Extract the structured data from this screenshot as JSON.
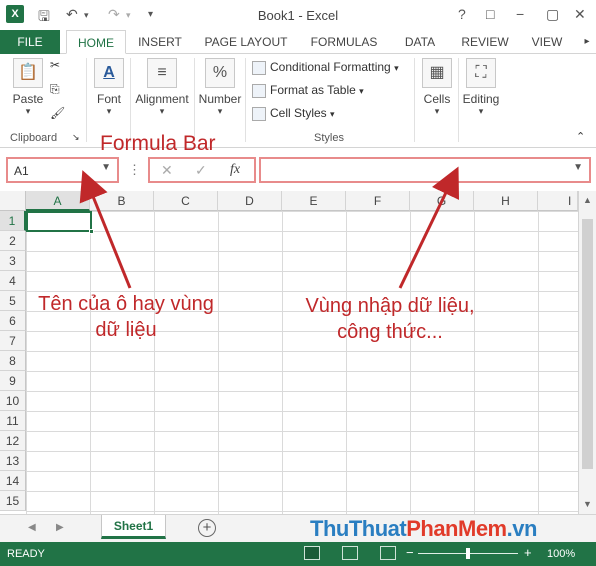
{
  "app": {
    "logo": "X",
    "title": "Book1 - Excel"
  },
  "quick_access": {
    "undo_icon": "undo-icon",
    "redo_icon": "redo-icon"
  },
  "window_controls": {
    "help": "?",
    "restore": "□",
    "minimize": "−",
    "close": "✕"
  },
  "ribbon_tabs": [
    "FILE",
    "HOME",
    "INSERT",
    "PAGE LAYOUT",
    "FORMULAS",
    "DATA",
    "REVIEW",
    "VIEW"
  ],
  "ribbon": {
    "paste": "Paste",
    "clipboard": "Clipboard",
    "font": "Font",
    "alignment": "Alignment",
    "number": "Number",
    "conditional_formatting": "Conditional Formatting",
    "format_as_table": "Format as Table",
    "cell_styles": "Cell Styles",
    "styles": "Styles",
    "cells": "Cells",
    "editing": "Editing"
  },
  "formula_bar": {
    "name_box": "A1",
    "cancel": "✕",
    "enter": "✓",
    "fx": "fx",
    "value": ""
  },
  "columns": [
    "A",
    "B",
    "C",
    "D",
    "E",
    "F",
    "G",
    "H",
    "I"
  ],
  "rows": [
    "1",
    "2",
    "3",
    "4",
    "5",
    "6",
    "7",
    "8",
    "9",
    "10",
    "11",
    "12",
    "13",
    "14",
    "15"
  ],
  "sheet_tabs": [
    "Sheet1"
  ],
  "status": {
    "ready": "READY",
    "zoom": "100%"
  },
  "annotations": {
    "formula_bar": "Formula Bar",
    "name_box_line1": "Tên của ô hay vùng",
    "name_box_line2": "dữ liệu",
    "input_line1": "Vùng nhập dữ liệu,",
    "input_line2": "công thức..."
  },
  "watermark": {
    "part1": "ThuThuat",
    "part2": "PhanMem",
    "part3": ".vn"
  },
  "colors": {
    "excel_green": "#217346",
    "annotation_red": "#c0282a"
  }
}
